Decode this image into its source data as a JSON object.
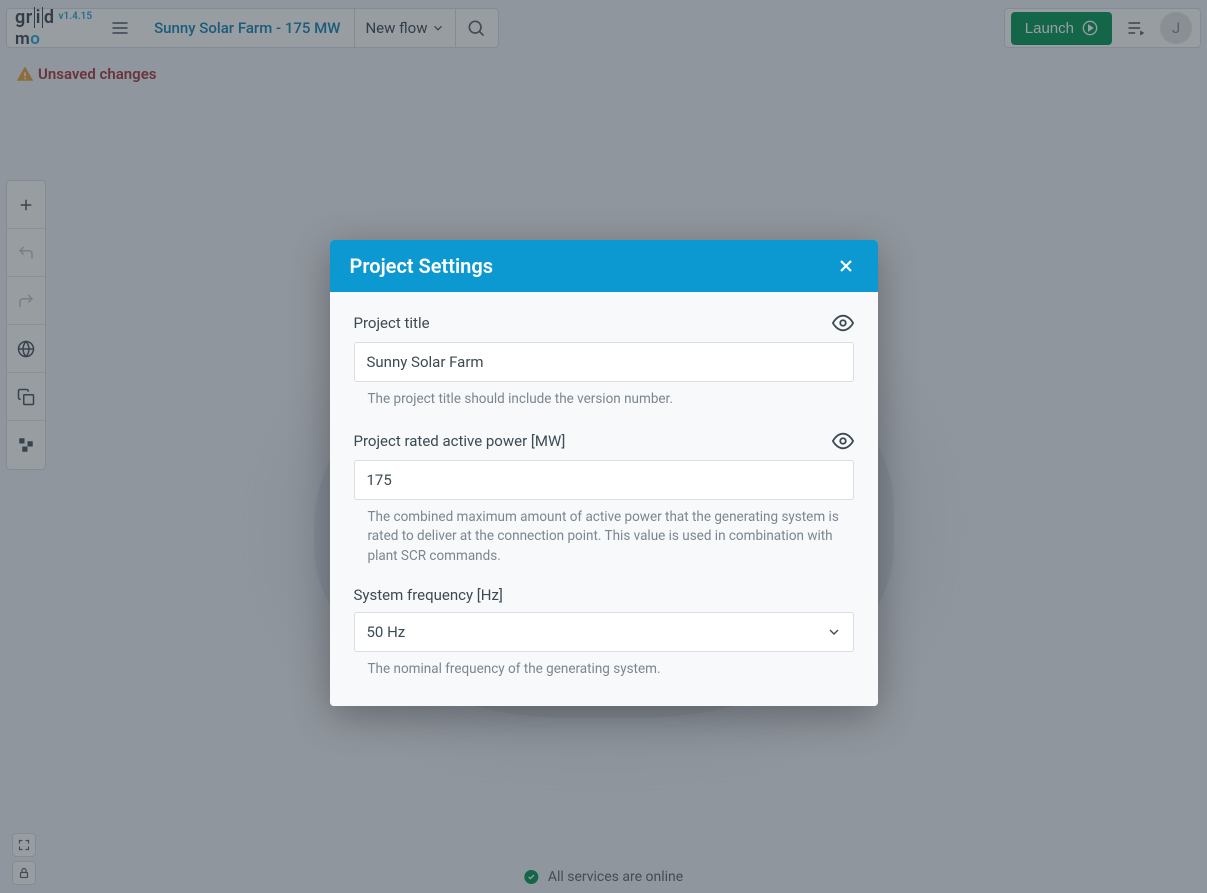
{
  "logo": {
    "text": "gridmo",
    "version": "v1.4.15"
  },
  "header": {
    "project_link": "Sunny Solar Farm - 175 MW",
    "flow_label": "New flow",
    "launch_label": "Launch",
    "avatar_initial": "J"
  },
  "banner": {
    "unsaved": "Unsaved changes"
  },
  "status": {
    "text": "All services are online"
  },
  "modal": {
    "title": "Project Settings",
    "fields": {
      "title": {
        "label": "Project title",
        "value": "Sunny Solar Farm",
        "help": "The project title should include the version number."
      },
      "power": {
        "label": "Project rated active power [MW]",
        "value": "175",
        "help": "The combined maximum amount of active power that the generating system is rated to deliver at the connection point. This value is used in combination with plant SCR commands."
      },
      "frequency": {
        "label": "System frequency [Hz]",
        "value": "50 Hz",
        "help": "The nominal frequency of the generating system."
      }
    }
  }
}
